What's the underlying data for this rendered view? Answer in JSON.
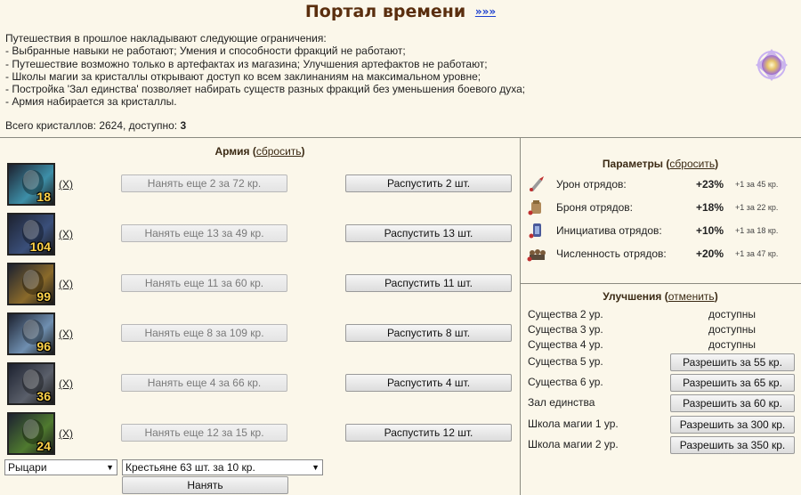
{
  "title": "Портал времени",
  "title_link": "»»»",
  "restrictions": [
    "Путешествия в прошлое накладывают следующие ограничения:",
    "- Выбранные навыки не работают; Умения и способности фракций не работают;",
    "- Путешествие возможно только в артефактах из магазина; Улучшения артефактов не работают;",
    "- Школы магии за кристаллы открывают доступ ко всем заклинаниям на максимальном уровне;",
    "- Постройка 'Зал единства' позволяет набирать существ разных фракций без уменьшения боевого духа;",
    "- Армия набирается за кристаллы."
  ],
  "crystals": {
    "label": "Всего кристаллов: 2624, доступно: ",
    "available": "3"
  },
  "army": {
    "title": "Армия",
    "reset_open": " (",
    "reset_label": "сбросить",
    "reset_close": ")",
    "remove_label": "(X)",
    "units": [
      {
        "count": "18",
        "hire": "Нанять еще 2 за 72 кр.",
        "dismiss": "Распустить 2 шт.",
        "color": "#3d8fa8"
      },
      {
        "count": "104",
        "hire": "Нанять еще 13 за 49 кр.",
        "dismiss": "Распустить 13 шт.",
        "color": "#3a4f7a"
      },
      {
        "count": "99",
        "hire": "Нанять еще 11 за 60 кр.",
        "dismiss": "Распустить 11 шт.",
        "color": "#8a6a2a"
      },
      {
        "count": "96",
        "hire": "Нанять еще 8 за 109 кр.",
        "dismiss": "Распустить 8 шт.",
        "color": "#6f8fb0"
      },
      {
        "count": "36",
        "hire": "Нанять еще 4 за 66 кр.",
        "dismiss": "Распустить 4 шт.",
        "color": "#5a5f6a"
      },
      {
        "count": "24",
        "hire": "Нанять еще 12 за 15 кр.",
        "dismiss": "Распустить 12 шт.",
        "color": "#4f7a2f"
      }
    ],
    "faction_select": "Рыцари",
    "creature_select": "Крестьяне 63 шт. за 10 кр.",
    "hire_button": "Нанять"
  },
  "params": {
    "title": "Параметры",
    "reset_open": " (",
    "reset_label": "сбросить",
    "reset_close": ")",
    "rows": [
      {
        "label": "Урон отрядов:",
        "value": "+23%",
        "cost": "+1 за 45 кр.",
        "icon": "damage-icon"
      },
      {
        "label": "Броня отрядов:",
        "value": "+18%",
        "cost": "+1 за 22 кр.",
        "icon": "armor-icon"
      },
      {
        "label": "Инициатива отрядов:",
        "value": "+10%",
        "cost": "+1 за 18 кр.",
        "icon": "initiative-icon"
      },
      {
        "label": "Численность отрядов:",
        "value": "+20%",
        "cost": "+1 за 47 кр.",
        "icon": "quantity-icon"
      }
    ]
  },
  "upgrades": {
    "title": "Улучшения",
    "cancel_open": " (",
    "cancel_label": "отменить",
    "cancel_close": ")",
    "available": [
      {
        "label": "Существа 2 ур.",
        "status": "доступны"
      },
      {
        "label": "Существа 3 ур.",
        "status": "доступны"
      },
      {
        "label": "Существа 4 ур.",
        "status": "доступны"
      }
    ],
    "purchasable": [
      {
        "label": "Существа 5 ур.",
        "button": "Разрешить за 55 кр."
      },
      {
        "label": "Существа 6 ур.",
        "button": "Разрешить за 65 кр."
      },
      {
        "label": "Зал единства",
        "button": "Разрешить за 60 кр."
      },
      {
        "label": "Школа магии 1 ур.",
        "button": "Разрешить за 300 кр."
      },
      {
        "label": "Школа магии 2 ур.",
        "button": "Разрешить за 350 кр."
      }
    ]
  }
}
